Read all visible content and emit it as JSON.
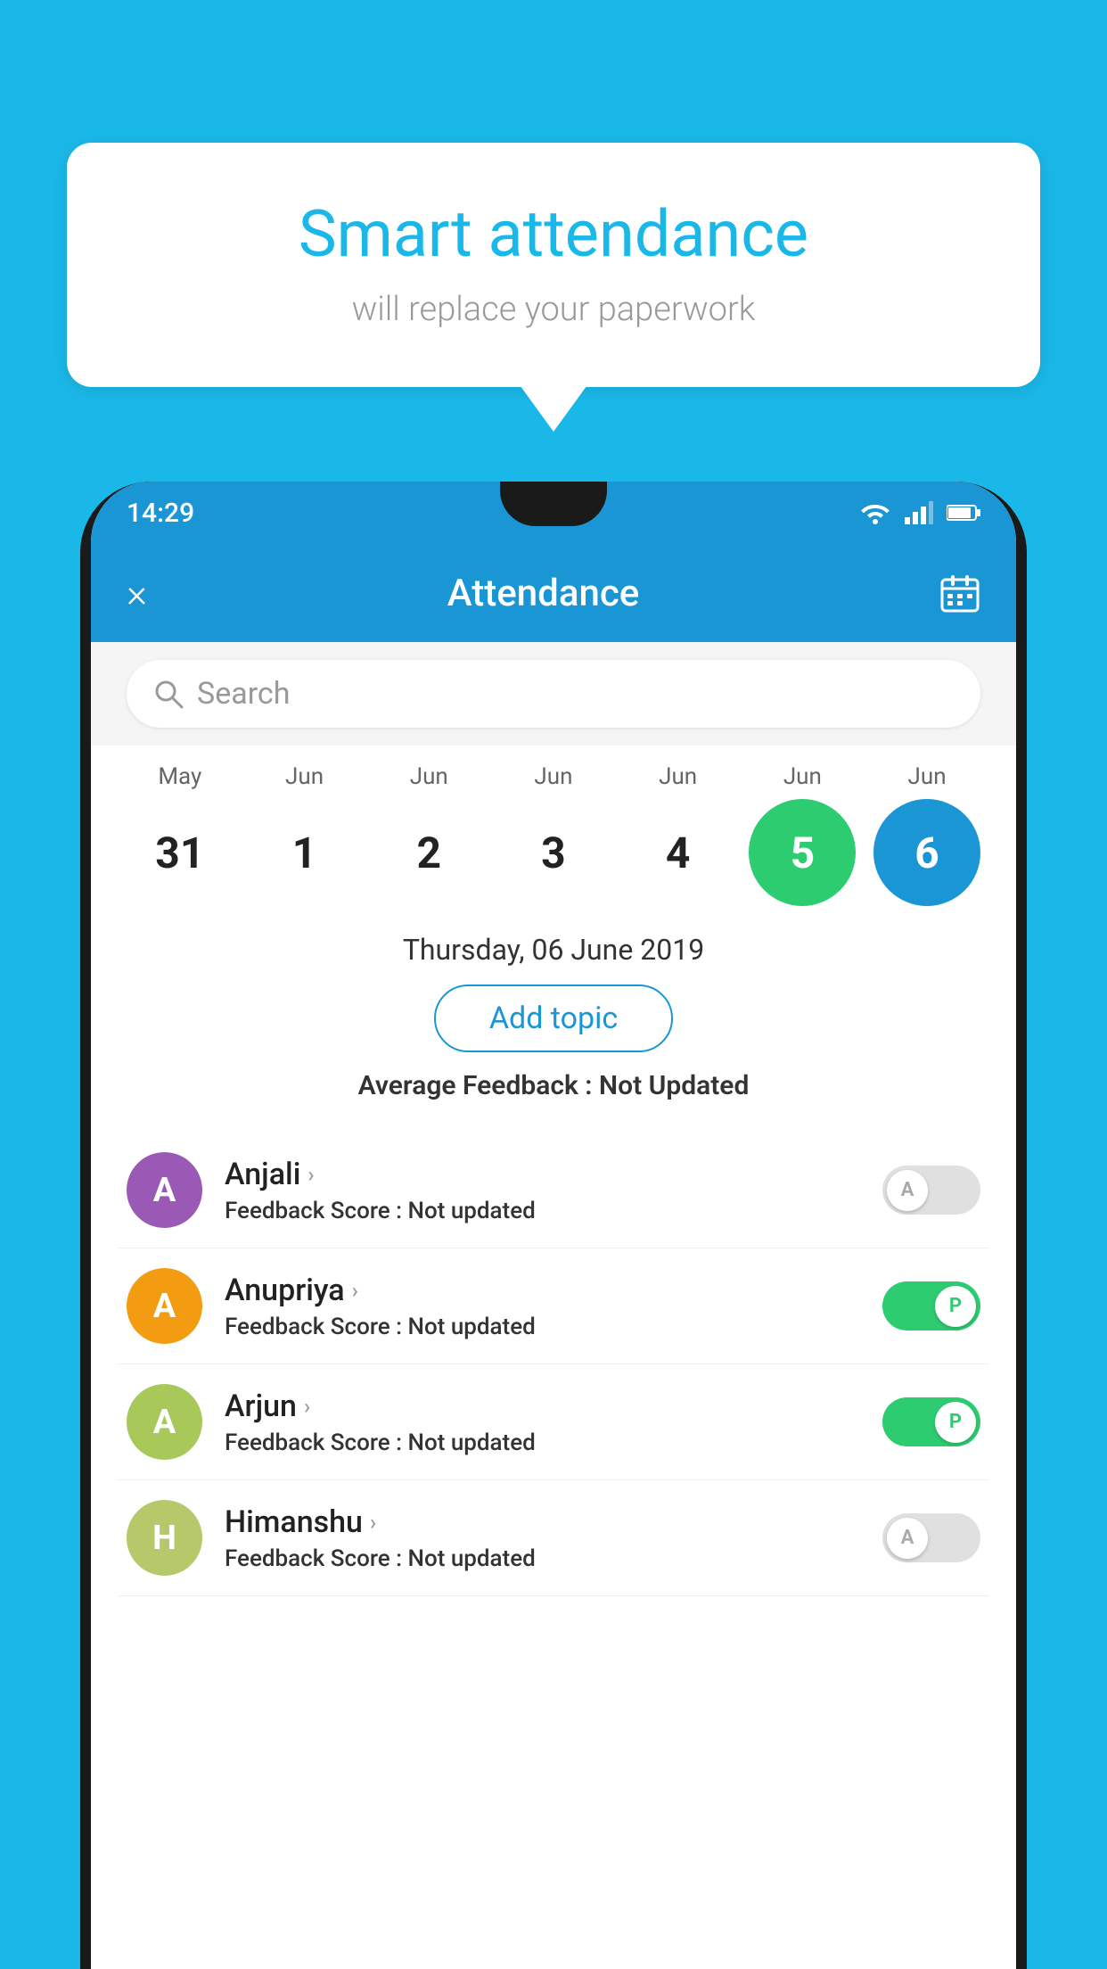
{
  "background_color": "#1ab8e8",
  "bubble": {
    "title": "Smart attendance",
    "subtitle": "will replace your paperwork"
  },
  "status_bar": {
    "time": "14:29",
    "icons": [
      "wifi",
      "signal",
      "battery"
    ]
  },
  "app_bar": {
    "title": "Attendance",
    "close_label": "×",
    "calendar_icon": "📅"
  },
  "search": {
    "placeholder": "Search"
  },
  "calendar": {
    "months": [
      "May",
      "Jun",
      "Jun",
      "Jun",
      "Jun",
      "Jun",
      "Jun"
    ],
    "dates": [
      "31",
      "1",
      "2",
      "3",
      "4",
      "5",
      "6"
    ],
    "states": [
      "normal",
      "normal",
      "normal",
      "normal",
      "normal",
      "today",
      "selected"
    ]
  },
  "selected_date": {
    "label": "Thursday, 06 June 2019",
    "add_topic_btn": "Add topic",
    "avg_feedback_label": "Average Feedback : ",
    "avg_feedback_value": "Not Updated"
  },
  "students": [
    {
      "name": "Anjali",
      "avatar_letter": "A",
      "avatar_color": "#9b59b6",
      "feedback_label": "Feedback Score : ",
      "feedback_value": "Not updated",
      "status": "absent"
    },
    {
      "name": "Anupriya",
      "avatar_letter": "A",
      "avatar_color": "#f39c12",
      "feedback_label": "Feedback Score : ",
      "feedback_value": "Not updated",
      "status": "present"
    },
    {
      "name": "Arjun",
      "avatar_letter": "A",
      "avatar_color": "#a8c85a",
      "feedback_label": "Feedback Score : ",
      "feedback_value": "Not updated",
      "status": "present"
    },
    {
      "name": "Himanshu",
      "avatar_letter": "H",
      "avatar_color": "#b5c96a",
      "feedback_label": "Feedback Score : ",
      "feedback_value": "Not updated",
      "status": "absent"
    }
  ]
}
